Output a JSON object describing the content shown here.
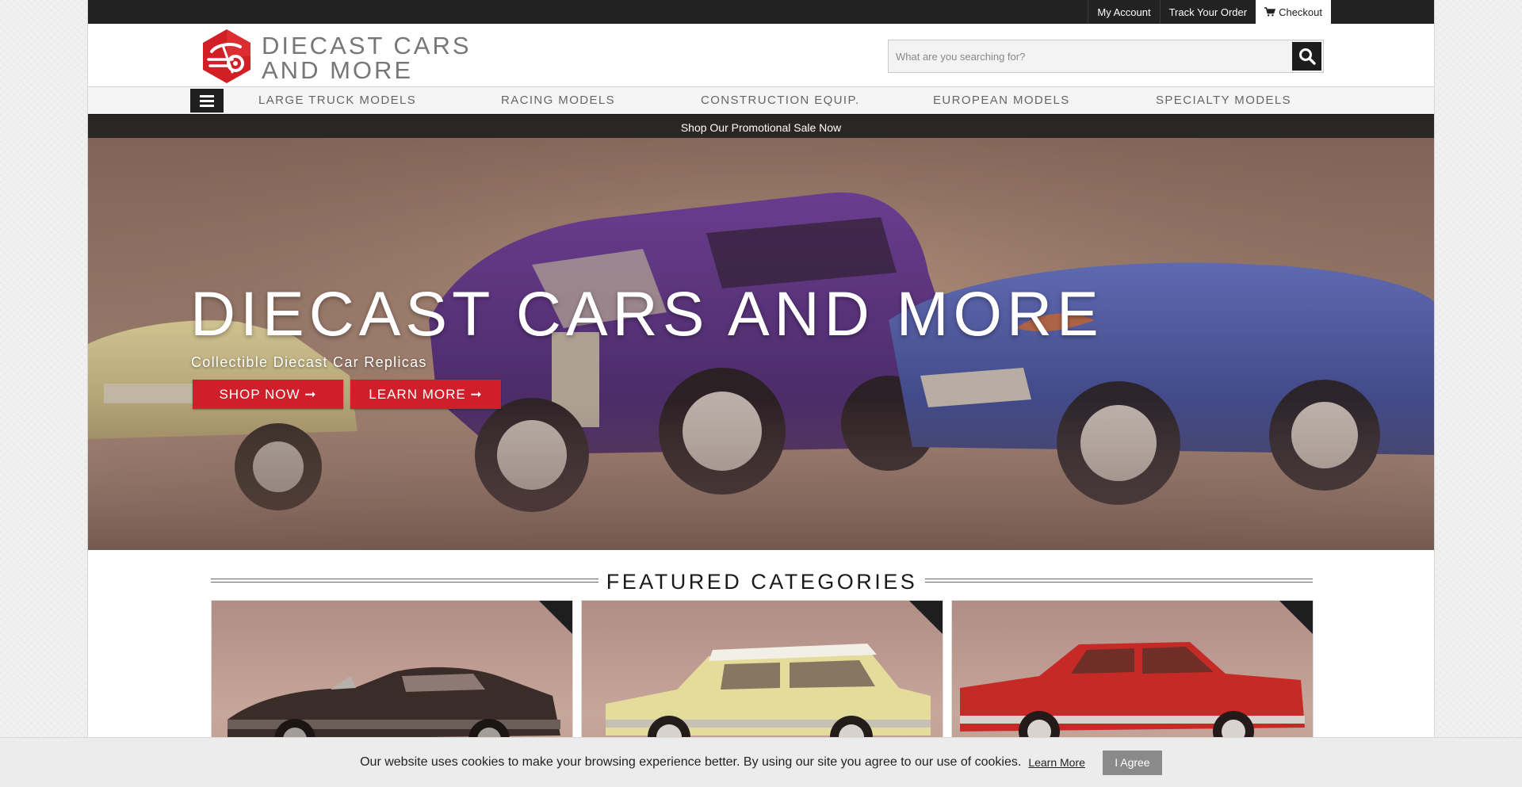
{
  "topbar": {
    "my_account": "My Account",
    "track_order": "Track Your Order",
    "checkout": "Checkout"
  },
  "header": {
    "logo_line1": "DIECAST CARS",
    "logo_line2": "AND MORE",
    "search_placeholder": "What are you searching for?"
  },
  "nav": {
    "items": [
      {
        "label": "LARGE TRUCK MODELS"
      },
      {
        "label": "RACING MODELS"
      },
      {
        "label": "CONSTRUCTION EQUIP."
      },
      {
        "label": "EUROPEAN MODELS"
      },
      {
        "label": "SPECIALTY MODELS"
      }
    ]
  },
  "promo": {
    "text": "Shop Our Promotional Sale Now"
  },
  "hero": {
    "title": "DIECAST CARS AND MORE",
    "subtitle": "Collectible Diecast Car Replicas",
    "shop_now": "SHOP NOW ➞",
    "learn_more": "LEARN MORE ➞"
  },
  "featured": {
    "heading": "FEATURED CATEGORIES"
  },
  "cookie": {
    "message": "Our website uses cookies to make your browsing experience better. By using our site you agree to our use of cookies.",
    "learn_more": "Learn More",
    "agree": "I Agree"
  },
  "colors": {
    "brand_red": "#d01f2a",
    "topbar_bg": "#222222",
    "promo_bg": "#2a2624"
  },
  "icons": {
    "logo": "car-wheel-logo-icon",
    "cart": "cart-icon",
    "search": "search-icon",
    "menu": "hamburger-menu-icon"
  }
}
